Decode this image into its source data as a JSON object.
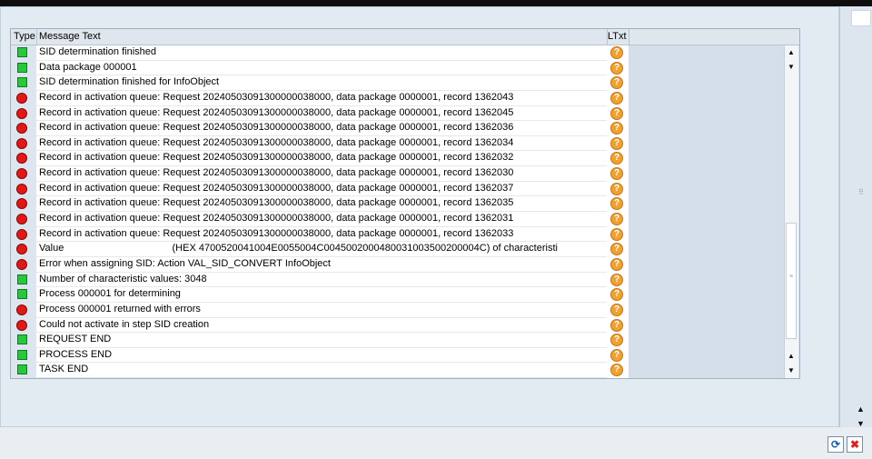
{
  "header": {
    "type": "Type",
    "message_text": "Message Text",
    "ltxt": "LTxt"
  },
  "messages": [
    {
      "status": "success",
      "text": "SID determination finished",
      "ltxt_icon": "help-icon"
    },
    {
      "status": "success",
      "text": "Data package 000001",
      "ltxt_icon": "help-icon"
    },
    {
      "status": "success",
      "text": "SID determination finished for InfoObject",
      "ltxt_icon": "help-icon"
    },
    {
      "status": "error",
      "text": "Record in activation queue: Request 20240503091300000038000, data package 0000001, record 1362043",
      "ltxt_icon": "help-icon"
    },
    {
      "status": "error",
      "text": "Record in activation queue: Request 20240503091300000038000, data package 0000001, record 1362045",
      "ltxt_icon": "help-icon"
    },
    {
      "status": "error",
      "text": "Record in activation queue: Request 20240503091300000038000, data package 0000001, record 1362036",
      "ltxt_icon": "help-icon"
    },
    {
      "status": "error",
      "text": "Record in activation queue: Request 20240503091300000038000, data package 0000001, record 1362034",
      "ltxt_icon": "help-icon"
    },
    {
      "status": "error",
      "text": "Record in activation queue: Request 20240503091300000038000, data package 0000001, record 1362032",
      "ltxt_icon": "help-icon"
    },
    {
      "status": "error",
      "text": "Record in activation queue: Request 20240503091300000038000, data package 0000001, record 1362030",
      "ltxt_icon": "help-icon"
    },
    {
      "status": "error",
      "text": "Record in activation queue: Request 20240503091300000038000, data package 0000001, record 1362037",
      "ltxt_icon": "help-icon"
    },
    {
      "status": "error",
      "text": "Record in activation queue: Request 20240503091300000038000, data package 0000001, record 1362035",
      "ltxt_icon": "help-icon"
    },
    {
      "status": "error",
      "text": "Record in activation queue: Request 20240503091300000038000, data package 0000001, record 1362031",
      "ltxt_icon": "help-icon"
    },
    {
      "status": "error",
      "text": "Record in activation queue: Request 20240503091300000038000, data package 0000001, record 1362033",
      "ltxt_icon": "help-icon"
    },
    {
      "status": "error",
      "text": "Value                                       (HEX 4700520041004E0055004C0045002000480031003500200004C) of characteristi",
      "ltxt_icon": "help-icon"
    },
    {
      "status": "error",
      "text": "Error when assigning SID: Action VAL_SID_CONVERT InfoObject",
      "ltxt_icon": "help-icon"
    },
    {
      "status": "success",
      "text": "Number of characteristic values: 3048",
      "ltxt_icon": "help-icon"
    },
    {
      "status": "success",
      "text": "Process 000001 for determining",
      "ltxt_icon": "help-icon"
    },
    {
      "status": "error",
      "text": "Process 000001 returned with errors",
      "ltxt_icon": "help-icon"
    },
    {
      "status": "error",
      "text": "Could not activate in step SID creation",
      "ltxt_icon": "help-icon"
    },
    {
      "status": "success",
      "text": "REQUEST END",
      "ltxt_icon": "help-icon"
    },
    {
      "status": "success",
      "text": "PROCESS END",
      "ltxt_icon": "help-icon"
    },
    {
      "status": "success",
      "text": "TASK END",
      "ltxt_icon": "help-icon"
    }
  ],
  "icons": {
    "status_success": "green-square-icon",
    "status_error": "red-circle-icon",
    "ltxt": "help-icon",
    "ok": "refresh-icon",
    "cancel": "close-icon"
  },
  "colors": {
    "success": "#27c93b",
    "error": "#e81515",
    "help": "#f2a12c",
    "cancel": "#e0201e"
  }
}
